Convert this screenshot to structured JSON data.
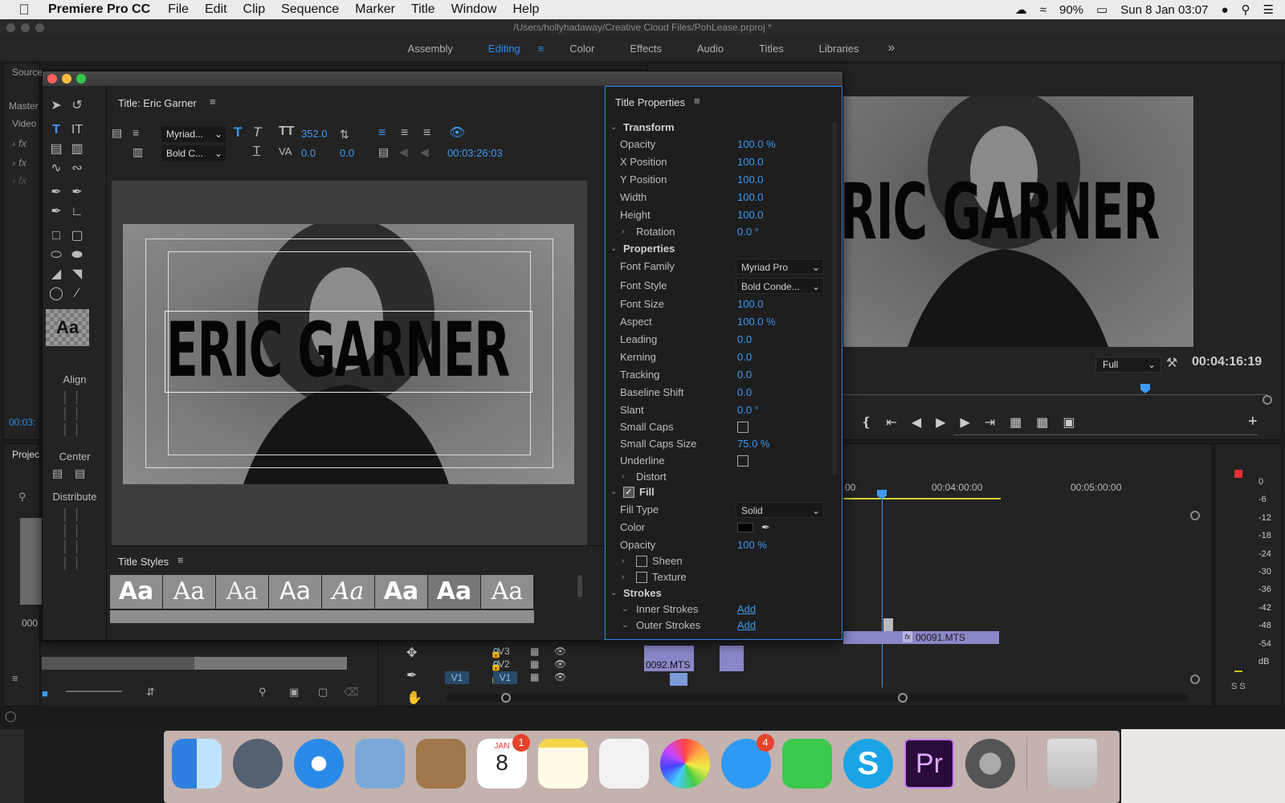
{
  "menubar": {
    "app": "Premiere Pro CC",
    "items": [
      "File",
      "Edit",
      "Clip",
      "Sequence",
      "Marker",
      "Title",
      "Window",
      "Help"
    ],
    "battery": "90%",
    "datetime": "Sun 8 Jan  03:07"
  },
  "window": {
    "path": "/Users/hollyhadaway/Creative Cloud Files/PohLease.prproj *"
  },
  "workspaces": [
    {
      "label": "Assembly",
      "active": false
    },
    {
      "label": "Editing",
      "active": true
    },
    {
      "label": "Color",
      "active": false
    },
    {
      "label": "Effects",
      "active": false
    },
    {
      "label": "Audio",
      "active": false
    },
    {
      "label": "Titles",
      "active": false
    },
    {
      "label": "Libraries",
      "active": false
    }
  ],
  "left_panel": {
    "source_tab": "Source",
    "master": "Master",
    "video": "Video",
    "timecode": "00:03:",
    "project_tab": "Projec",
    "clip_label": "000"
  },
  "title_editor": {
    "title": "Title: Eric Garner",
    "font_short": "Myriad...",
    "style_short": "Bold C...",
    "size": "352.0",
    "kern": "0.0",
    "lead": "0.0",
    "timecode": "00:03:26:03",
    "text": "ERIC GARNER",
    "swatch_label": "Aa",
    "align_label": "Align",
    "center_label": "Center",
    "distribute_label": "Distribute",
    "styles_tab": "Title Styles",
    "swatches": [
      "Aa",
      "Aa",
      "Aa",
      "Aa",
      "Aa",
      "Aa",
      "Aa",
      "Aa"
    ]
  },
  "properties": {
    "header": "Title Properties",
    "transform": "Transform",
    "opacity": {
      "label": "Opacity",
      "value": "100.0 %"
    },
    "x_position": {
      "label": "X Position",
      "value": "100.0"
    },
    "y_position": {
      "label": "Y Position",
      "value": "100.0"
    },
    "width": {
      "label": "Width",
      "value": "100.0"
    },
    "height": {
      "label": "Height",
      "value": "100.0"
    },
    "rotation": {
      "label": "Rotation",
      "value": "0.0 °"
    },
    "properties": "Properties",
    "font_family": {
      "label": "Font Family",
      "value": "Myriad Pro"
    },
    "font_style": {
      "label": "Font Style",
      "value": "Bold Conde..."
    },
    "font_size": {
      "label": "Font Size",
      "value": "100.0"
    },
    "aspect": {
      "label": "Aspect",
      "value": "100.0 %"
    },
    "leading": {
      "label": "Leading",
      "value": "0.0"
    },
    "kerning": {
      "label": "Kerning",
      "value": "0.0"
    },
    "tracking": {
      "label": "Tracking",
      "value": "0.0"
    },
    "baseline_shift": {
      "label": "Baseline Shift",
      "value": "0.0"
    },
    "slant": {
      "label": "Slant",
      "value": "0.0 °"
    },
    "small_caps": {
      "label": "Small Caps"
    },
    "small_caps_size": {
      "label": "Small Caps Size",
      "value": "75.0 %"
    },
    "underline": {
      "label": "Underline"
    },
    "distort": "Distort",
    "fill": "Fill",
    "fill_type": {
      "label": "Fill Type",
      "value": "Solid"
    },
    "color": {
      "label": "Color",
      "value": "#000000"
    },
    "fill_opacity": {
      "label": "Opacity",
      "value": "100 %"
    },
    "sheen": "Sheen",
    "texture": "Texture",
    "strokes": "Strokes",
    "inner_strokes": {
      "label": "Inner Strokes",
      "value": "Add"
    },
    "outer_strokes": {
      "label": "Outer Strokes",
      "value": "Add"
    }
  },
  "program": {
    "text": "RIC GARNER",
    "zoom": "Full",
    "timecode": "00:04:16:19"
  },
  "timeline": {
    "t1": "00",
    "t2": "00:04:00:00",
    "t3": "00:05:00:00",
    "clip_a": "00091.MTS",
    "clip_b": "0092.MTS",
    "tracks": [
      "V3",
      "V2",
      "V1"
    ],
    "source_track": "V1"
  },
  "meters": [
    "0",
    "-6",
    "-12",
    "-18",
    "-24",
    "-30",
    "-36",
    "-42",
    "-48",
    "-54",
    "dB"
  ],
  "meter_solo": "S S",
  "dock": {
    "calendar_month": "JAN",
    "calendar_day": "8",
    "calendar_badge": "1",
    "messages_badge": "4",
    "premiere_label": "Pr"
  },
  "colors": {
    "accent": "#2d8ceb",
    "value_blue": "#3e99f2",
    "panel": "#232323"
  }
}
